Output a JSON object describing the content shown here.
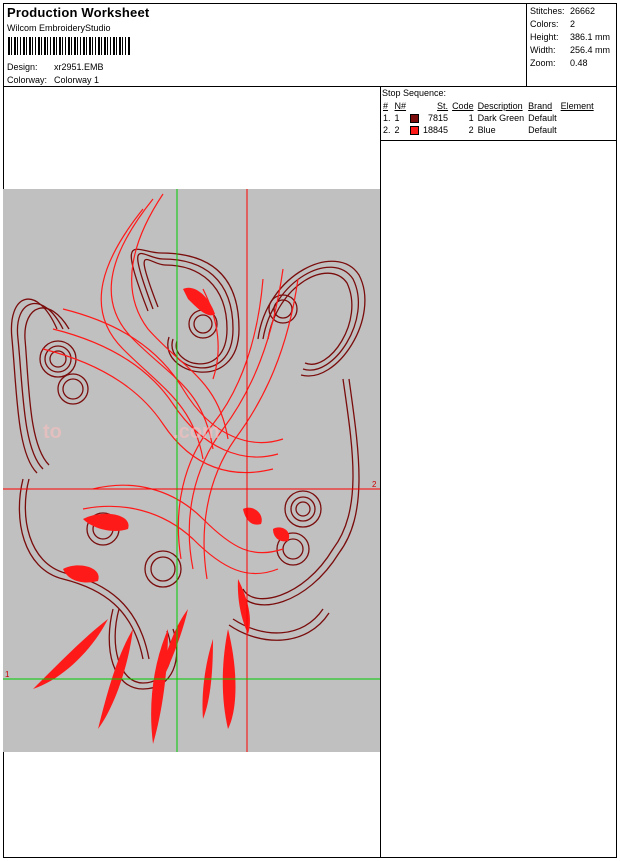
{
  "header": {
    "title": "Production Worksheet",
    "software": "Wilcom  EmbroideryStudio"
  },
  "design": {
    "design_label": "Design:",
    "design_value": "xr2951.EMB",
    "colorway_label": "Colorway:",
    "colorway_value": "Colorway 1"
  },
  "stats": {
    "stitches_label": "Stitches:",
    "stitches_value": "26662",
    "colors_label": "Colors:",
    "colors_value": "2",
    "height_label": "Height:",
    "height_value": "386.1 mm",
    "width_label": "Width:",
    "width_value": "256.4 mm",
    "zoom_label": "Zoom:",
    "zoom_value": "0.48"
  },
  "stop_sequence": {
    "title": "Stop Sequence:",
    "columns": [
      "#",
      "N#",
      "St.",
      "Code",
      "Description",
      "Brand",
      "Element"
    ],
    "rows": [
      {
        "num": "1.",
        "n": "1",
        "color": "#7a0c0c",
        "st": "7815",
        "code": "1",
        "description": "Dark Green",
        "brand": "Default",
        "element": ""
      },
      {
        "num": "2.",
        "n": "2",
        "color": "#ff1a1a",
        "st": "18845",
        "code": "2",
        "description": "Blue",
        "brand": "Default",
        "element": ""
      }
    ]
  },
  "canvas": {
    "marker_right": "2",
    "marker_left": "1",
    "watermark": "to                    .com"
  },
  "colors": {
    "thread_dark": "#7a0c0c",
    "thread_red": "#ff1a1a",
    "canvas_bg": "#c0c0c0",
    "guide_green": "#00cc00",
    "guide_red": "#ff0000"
  }
}
